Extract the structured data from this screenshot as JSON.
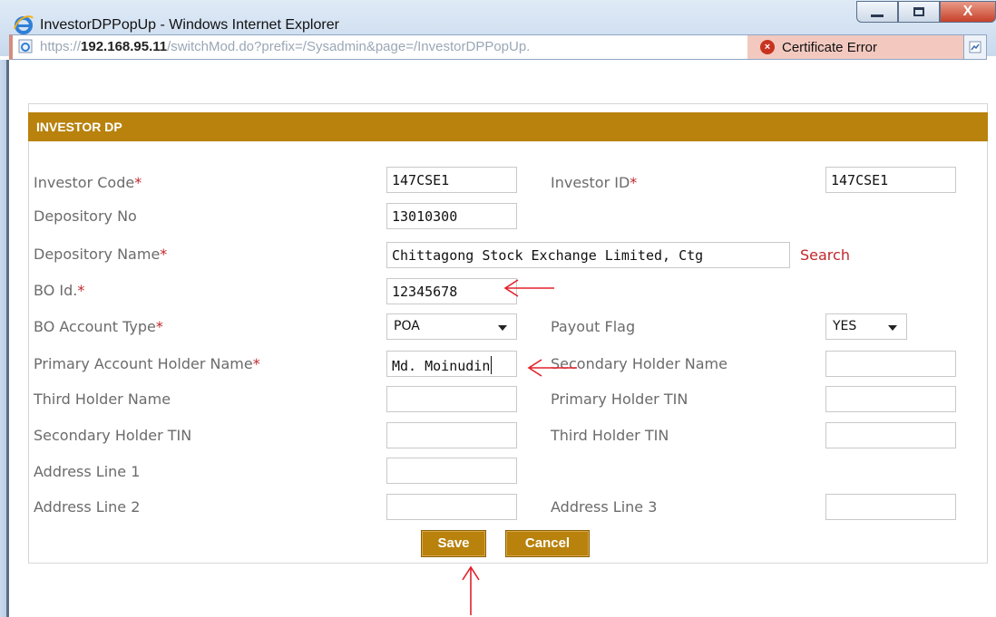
{
  "window": {
    "title": "InvestorDPPopUp - Windows Internet Explorer",
    "close_label": "X"
  },
  "address": {
    "prefix": "https://",
    "host": "192.168.95.11",
    "path": "/switchMod.do?prefix=/Sysadmin&page=/InvestorDPPopUp.",
    "cert_error": "Certificate Error"
  },
  "panel": {
    "title": "INVESTOR DP"
  },
  "form": {
    "investor_code": {
      "label": "Investor Code",
      "value": "147CSE1"
    },
    "investor_id": {
      "label": "Investor ID",
      "value": "147CSE1"
    },
    "depository_no": {
      "label": "Depository No",
      "value": "13010300"
    },
    "depository_name": {
      "label": "Depository Name",
      "value": "Chittagong Stock Exchange Limited, Ctg"
    },
    "search_label": "Search",
    "bo_id": {
      "label": "BO Id.",
      "value": "12345678"
    },
    "bo_account_type": {
      "label": "BO Account Type",
      "value": "POA"
    },
    "payout_flag": {
      "label": "Payout Flag",
      "value": "YES"
    },
    "primary_holder_name": {
      "label": "Primary Account Holder Name",
      "value": "Md. Moinudin"
    },
    "secondary_holder_name": {
      "label": "Secondary Holder Name",
      "value": ""
    },
    "third_holder_name": {
      "label": "Third Holder Name",
      "value": ""
    },
    "primary_holder_tin": {
      "label": "Primary Holder TIN",
      "value": ""
    },
    "secondary_holder_tin": {
      "label": "Secondary Holder TIN",
      "value": ""
    },
    "third_holder_tin": {
      "label": "Third Holder TIN",
      "value": ""
    },
    "address_line_1": {
      "label": "Address Line 1",
      "value": ""
    },
    "address_line_2": {
      "label": "Address Line 2",
      "value": ""
    },
    "address_line_3": {
      "label": "Address Line 3",
      "value": ""
    },
    "required_mark": "*"
  },
  "buttons": {
    "save": "Save",
    "cancel": "Cancel"
  },
  "colors": {
    "header_bg": "#b8820d",
    "required": "#c0282c",
    "annotation_arrow": "#e3202a"
  }
}
